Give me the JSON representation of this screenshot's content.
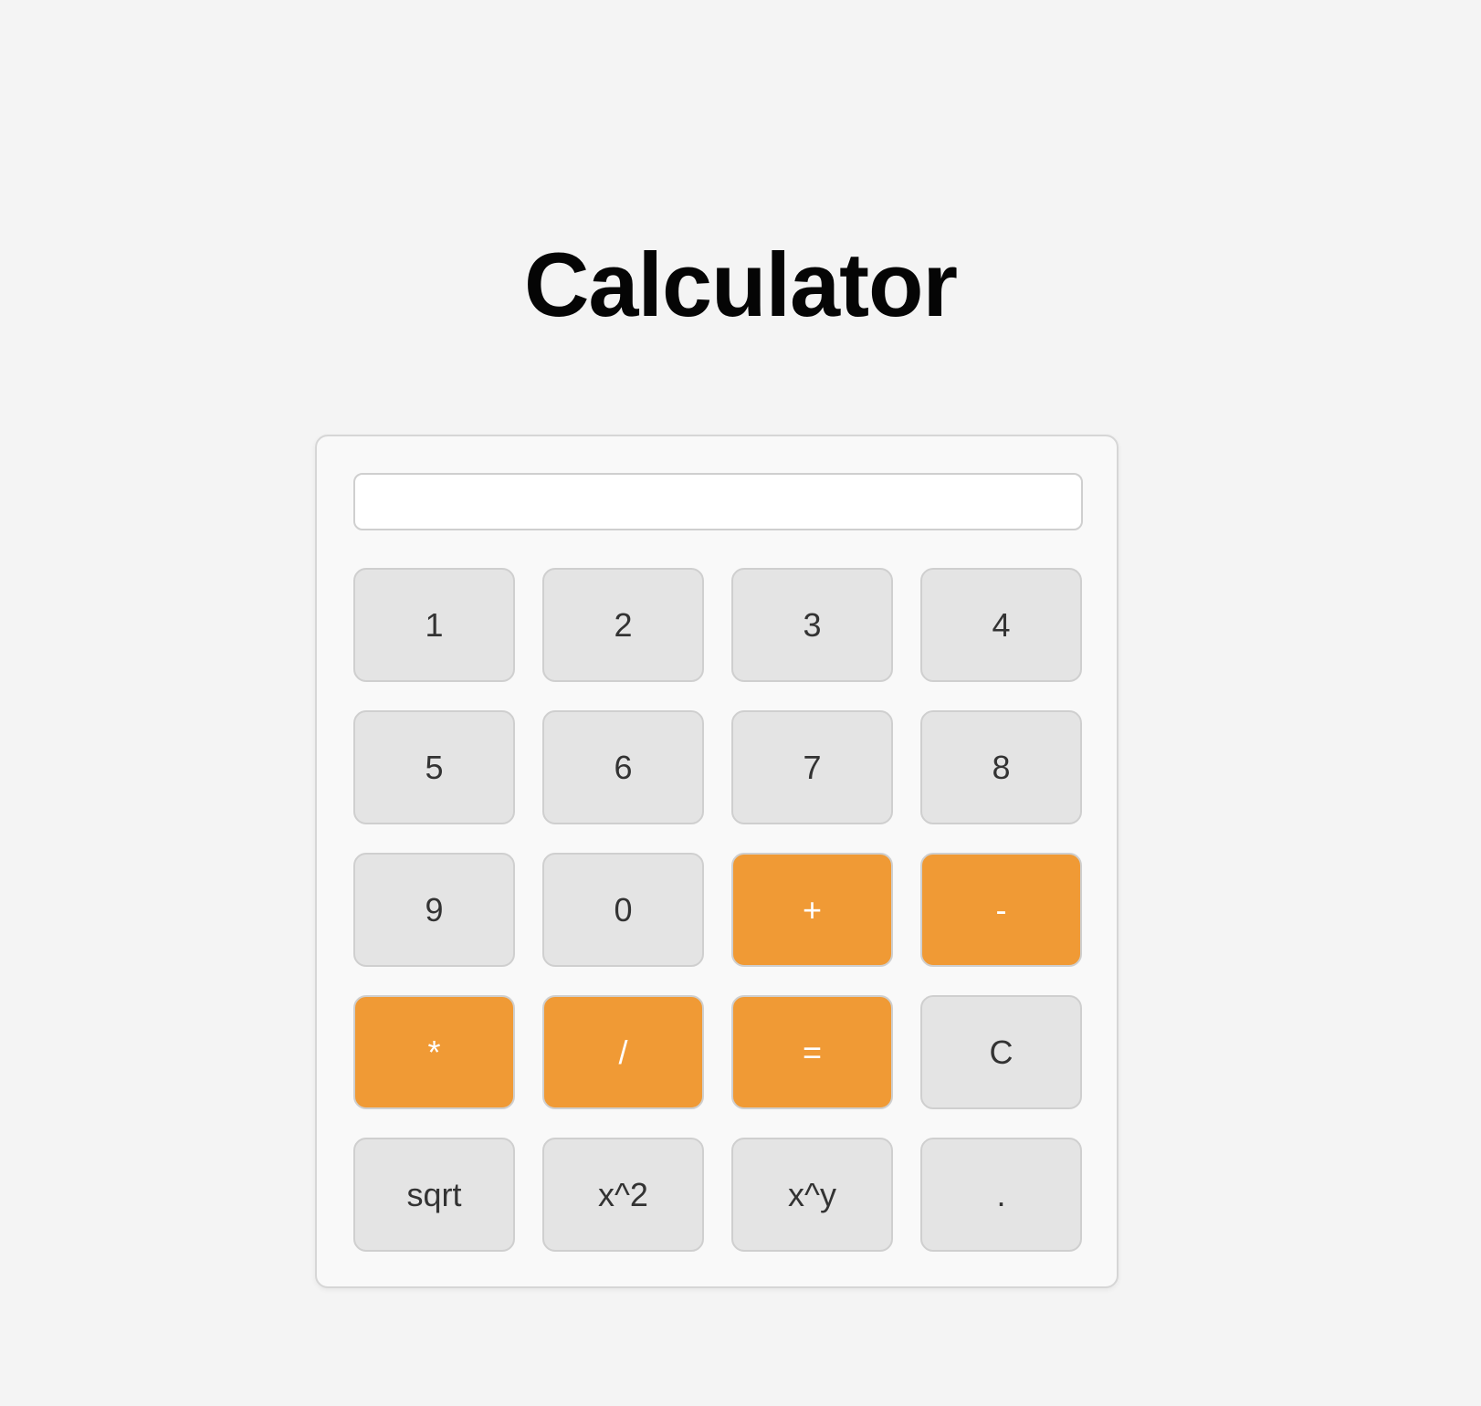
{
  "page": {
    "title": "Calculator"
  },
  "display": {
    "value": ""
  },
  "colors": {
    "background": "#f4f4f4",
    "key": "#e4e4e4",
    "operator_key": "#f09a35",
    "operator_text": "#ffffff"
  },
  "keys": [
    {
      "label": "1",
      "name": "key-1-button",
      "type": "digit"
    },
    {
      "label": "2",
      "name": "key-2-button",
      "type": "digit"
    },
    {
      "label": "3",
      "name": "key-3-button",
      "type": "digit"
    },
    {
      "label": "4",
      "name": "key-4-button",
      "type": "digit"
    },
    {
      "label": "5",
      "name": "key-5-button",
      "type": "digit"
    },
    {
      "label": "6",
      "name": "key-6-button",
      "type": "digit"
    },
    {
      "label": "7",
      "name": "key-7-button",
      "type": "digit"
    },
    {
      "label": "8",
      "name": "key-8-button",
      "type": "digit"
    },
    {
      "label": "9",
      "name": "key-9-button",
      "type": "digit"
    },
    {
      "label": "0",
      "name": "key-0-button",
      "type": "digit"
    },
    {
      "label": "+",
      "name": "add-button",
      "type": "operator"
    },
    {
      "label": "-",
      "name": "subtract-button",
      "type": "operator"
    },
    {
      "label": "*",
      "name": "multiply-button",
      "type": "operator"
    },
    {
      "label": "/",
      "name": "divide-button",
      "type": "operator"
    },
    {
      "label": "=",
      "name": "equals-button",
      "type": "operator"
    },
    {
      "label": "C",
      "name": "clear-button",
      "type": "function"
    },
    {
      "label": "sqrt",
      "name": "sqrt-button",
      "type": "function"
    },
    {
      "label": "x^2",
      "name": "square-button",
      "type": "function"
    },
    {
      "label": "x^y",
      "name": "power-button",
      "type": "function"
    },
    {
      "label": ".",
      "name": "decimal-button",
      "type": "function"
    }
  ]
}
